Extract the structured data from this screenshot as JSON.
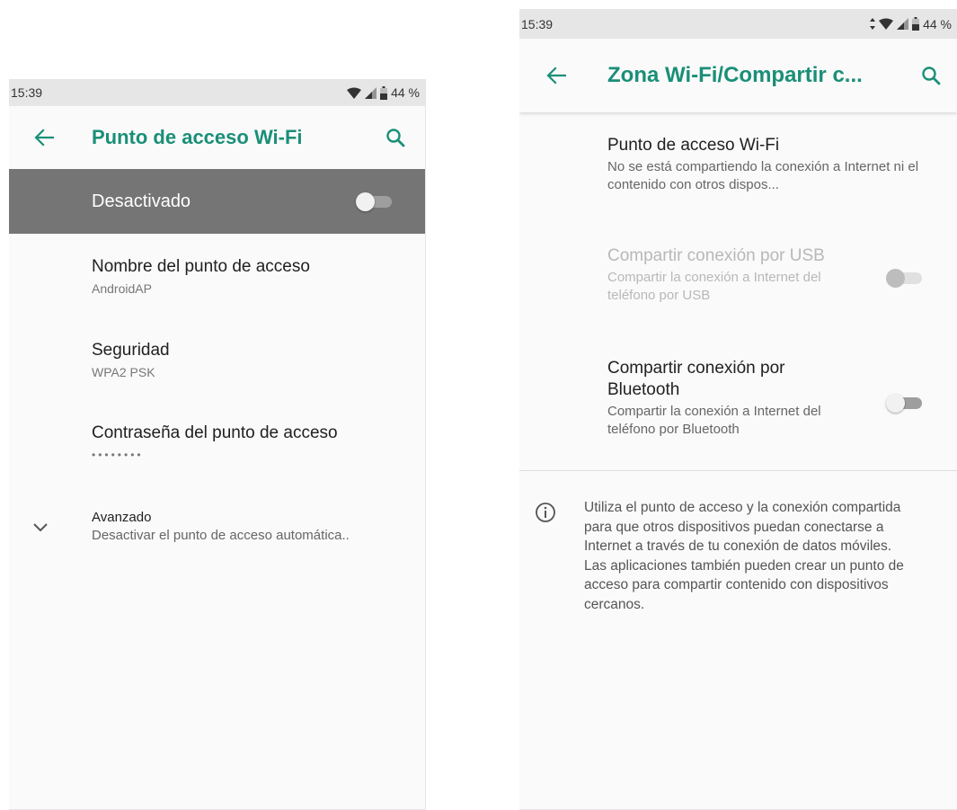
{
  "left_screen": {
    "status": {
      "time": "15:39",
      "battery": "44 %"
    },
    "app_bar": {
      "title": "Punto de acceso Wi-Fi"
    },
    "master_switch": {
      "label": "Desactivado",
      "on": false
    },
    "items": [
      {
        "title": "Nombre del punto de acceso",
        "summary": "AndroidAP"
      },
      {
        "title": "Seguridad",
        "summary": "WPA2 PSK"
      },
      {
        "title": "Contraseña del punto de acceso",
        "summary": "••••••••"
      }
    ],
    "advanced": {
      "title": "Avanzado",
      "summary": "Desactivar el punto de acceso automática.."
    }
  },
  "right_screen": {
    "status": {
      "time": "15:39",
      "battery": "44 %"
    },
    "app_bar": {
      "title": "Zona Wi-Fi/Compartir c..."
    },
    "items": [
      {
        "title": "Punto de acceso Wi-Fi",
        "summary": "No se está compartiendo la conexión a Internet ni el contenido con otros dispos..."
      },
      {
        "title": "Compartir conexión por USB",
        "summary": "Compartir la conexión a Internet del teléfono por USB",
        "enabled": false,
        "on": false
      },
      {
        "title": "Compartir conexión por Bluetooth",
        "summary": "Compartir la conexión a Internet del teléfono por Bluetooth",
        "enabled": true,
        "on": false
      }
    ],
    "info": "Utiliza el punto de acceso y la conexión compartida para que otros dispositivos puedan conectarse a Internet a través de tu conexión de datos móviles. Las aplicaciones también pueden crear un punto de acceso para compartir contenido con dispositivos cercanos."
  },
  "colors": {
    "accent": "#1a8f78",
    "appbar_band": "#757575",
    "status_bar": "#e6e6e6"
  },
  "icons": {
    "back": "arrow-left-icon",
    "search": "search-icon",
    "wifi": "wifi-icon",
    "signal": "signal-icon",
    "battery": "battery-icon",
    "expand": "chevron-down-icon",
    "info": "info-icon",
    "data": "data-arrows-icon"
  }
}
